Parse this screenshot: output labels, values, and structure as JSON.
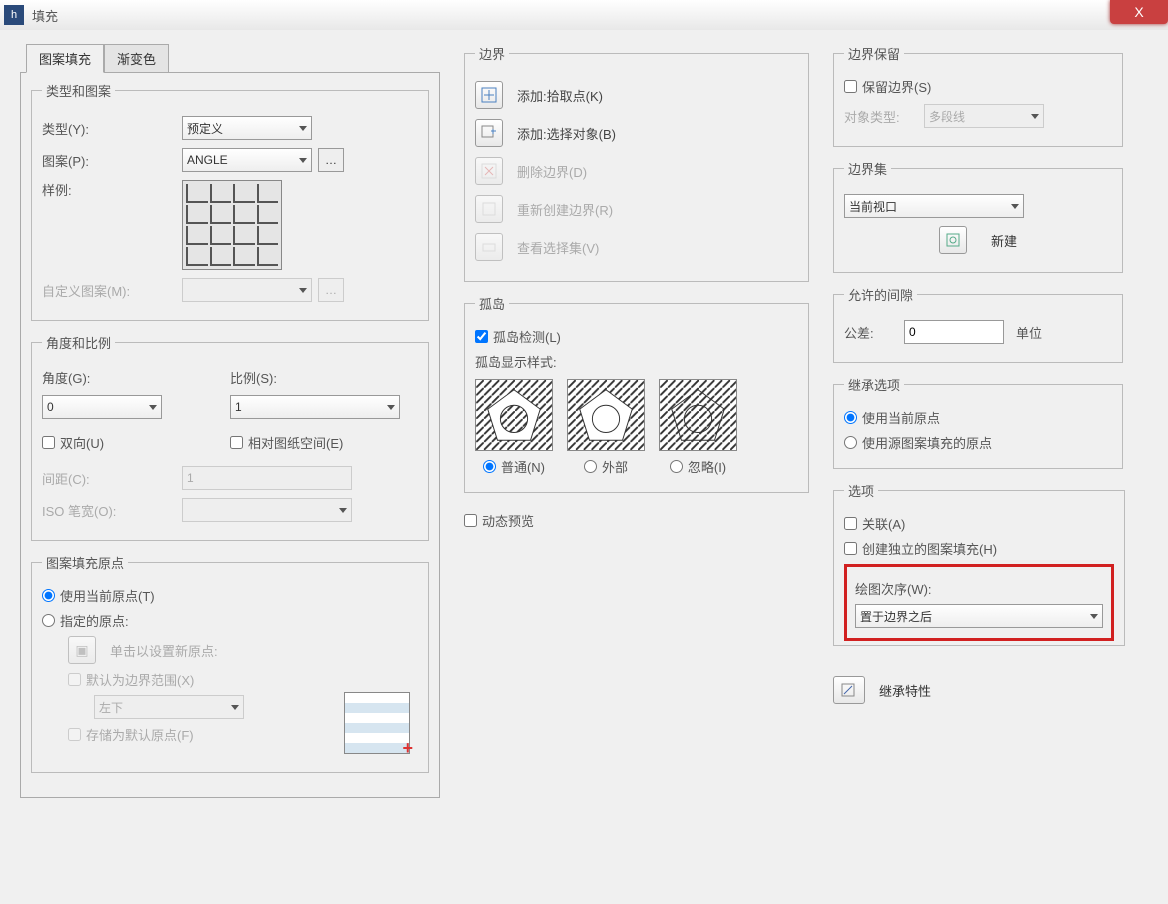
{
  "window": {
    "title": "填充",
    "close": "X"
  },
  "tabs": {
    "hatch": "图案填充",
    "gradient": "渐变色"
  },
  "typeAndPattern": {
    "legend": "类型和图案",
    "typeLabel": "类型(Y):",
    "typeValue": "预定义",
    "patternLabel": "图案(P):",
    "patternValue": "ANGLE",
    "swatchLabel": "样例:",
    "customLabel": "自定义图案(M):"
  },
  "angleScale": {
    "legend": "角度和比例",
    "angleLabel": "角度(G):",
    "angleValue": "0",
    "scaleLabel": "比例(S):",
    "scaleValue": "1",
    "doubleLabel": "双向(U)",
    "relativeLabel": "相对图纸空间(E)",
    "spacingLabel": "间距(C):",
    "spacingValue": "1",
    "isoLabel": "ISO 笔宽(O):"
  },
  "origin": {
    "legend": "图案填充原点",
    "useCurrent": "使用当前原点(T)",
    "specified": "指定的原点:",
    "clickToSet": "单击以设置新原点:",
    "defaultExtents": "默认为边界范围(X)",
    "extentsValue": "左下",
    "storeDefault": "存储为默认原点(F)"
  },
  "boundaries": {
    "title": "边界",
    "addPick": "添加:拾取点(K)",
    "addSelect": "添加:选择对象(B)",
    "remove": "删除边界(D)",
    "recreate": "重新创建边界(R)",
    "viewSel": "查看选择集(V)"
  },
  "islands": {
    "title": "孤岛",
    "detection": "孤岛检测(L)",
    "styleTitle": "孤岛显示样式:",
    "normal": "普通(N)",
    "outer": "外部",
    "ignore": "忽略(I)"
  },
  "dynamic": "动态预览",
  "boundaryRetain": {
    "title": "边界保留",
    "keep": "保留边界(S)",
    "objTypeLabel": "对象类型:",
    "objTypeValue": "多段线"
  },
  "boundarySet": {
    "title": "边界集",
    "value": "当前视口",
    "newBtn": "新建"
  },
  "gap": {
    "title": "允许的间隙",
    "toleranceLabel": "公差:",
    "toleranceValue": "0",
    "unit": "单位"
  },
  "inheritOptions": {
    "title": "继承选项",
    "useCurrent": "使用当前原点",
    "useSource": "使用源图案填充的原点"
  },
  "options": {
    "title": "选项",
    "associative": "关联(A)",
    "separate": "创建独立的图案填充(H)",
    "drawOrderLabel": "绘图次序(W):",
    "drawOrderValue": "置于边界之后"
  },
  "inheritProps": "继承特性"
}
